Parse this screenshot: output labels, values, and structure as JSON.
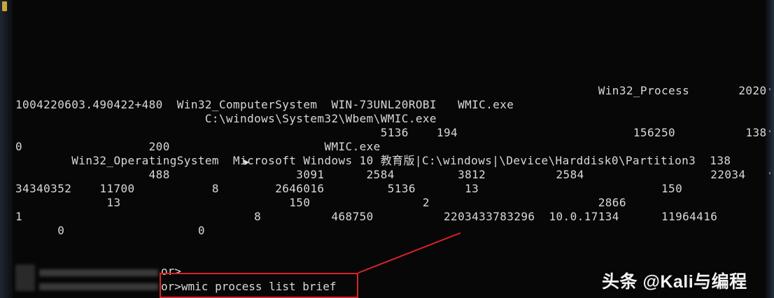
{
  "terminal": {
    "output_lines": [
      "                                                                                   Win32_Process       2020",
      "1004220603.490422+480  Win32_ComputerSystem  WIN-73UNL20ROBI   WMIC.exe",
      "                           C:\\windows\\System32\\Wbem\\WMIC.exe",
      "                                                    5136    194                         156250          138",
      "0                  200                      WMIC.exe",
      "        Win32_OperatingSystem  Microsoft Windows 10 教育版|C:\\windows|\\Device\\Harddisk0\\Partition3  138",
      "                   488                  3091      2584         3812          2584                  22034",
      "34340352    11700           8        2646016         5136       13                          150",
      "             13                        150                2                        2866",
      "1                                 8          468750          2203433783296  10.0.17134      11964416",
      "      0                   0"
    ],
    "prompt_partial": "or>",
    "command_partial": "or>wmic process list brief",
    "colors": {
      "background": "#070707",
      "text": "#d9d9d9",
      "annotation": "#d8232a"
    }
  },
  "watermark": {
    "text": "头条 @Kali与编程"
  }
}
